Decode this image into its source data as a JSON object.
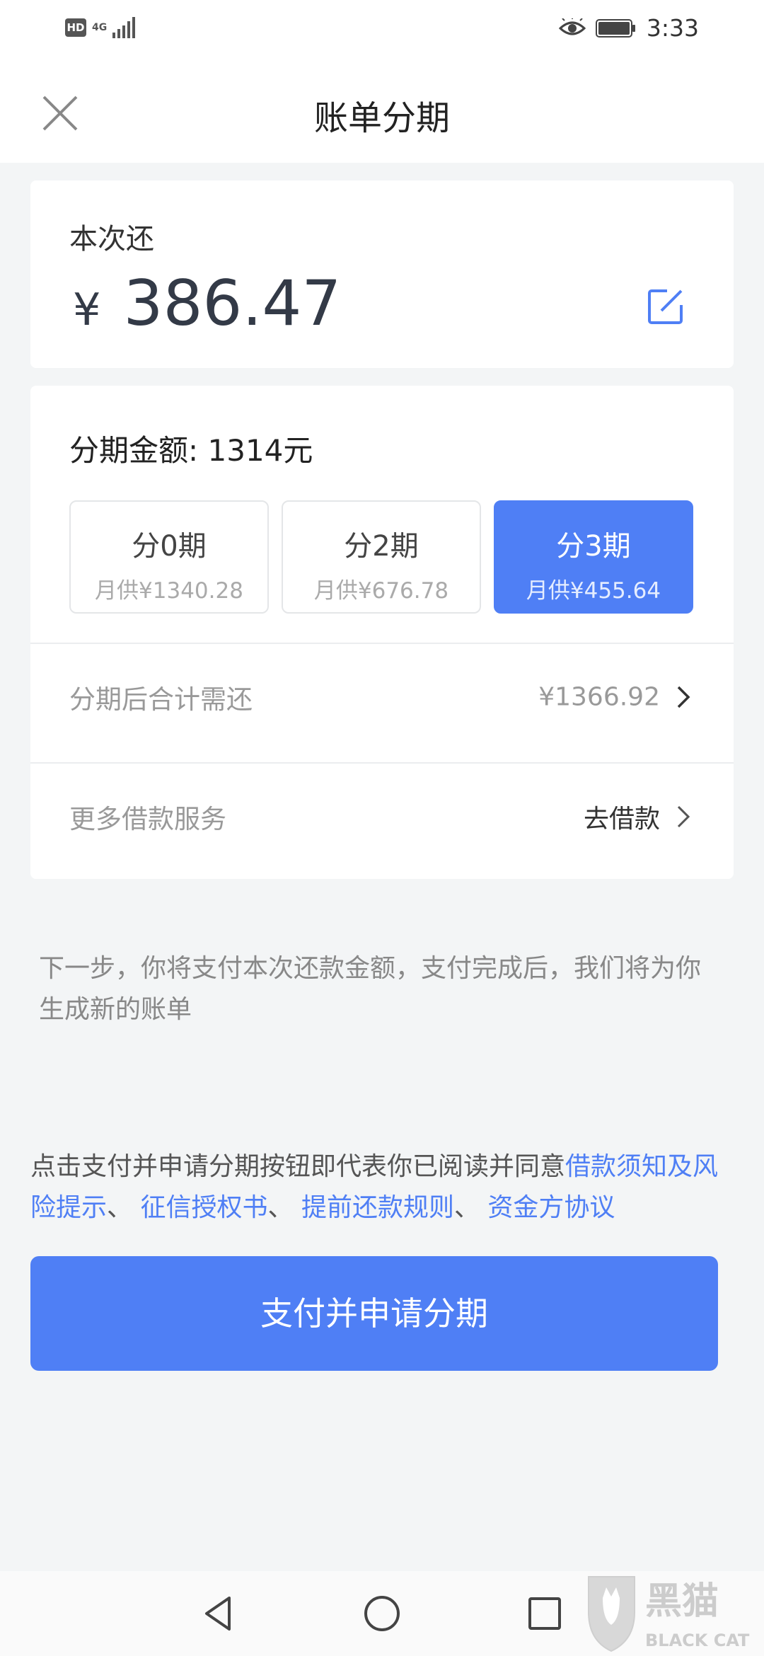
{
  "status_bar": {
    "hd": "HD",
    "network": "4G",
    "time": "3:33"
  },
  "header": {
    "title": "账单分期"
  },
  "payment": {
    "label": "本次还",
    "currency": "¥",
    "amount": "386.47"
  },
  "installment": {
    "amount_text": "分期金额: 1314元",
    "options": [
      {
        "title": "分0期",
        "monthly": "月供¥1340.28",
        "selected": false
      },
      {
        "title": "分2期",
        "monthly": "月供¥676.78",
        "selected": false
      },
      {
        "title": "分3期",
        "monthly": "月供¥455.64",
        "selected": true
      }
    ],
    "total_label": "分期后合计需还",
    "total_value": "¥1366.92",
    "more_label": "更多借款服务",
    "more_action": "去借款"
  },
  "note": "下一步，你将支付本次还款金额，支付完成后，我们将为你生成新的账单",
  "agreement": {
    "prefix": "点击支付并申请分期按钮即代表你已阅读并同意",
    "links": [
      "借款须知及风险提示",
      "征信授权书",
      "提前还款规则",
      "资金方协议"
    ],
    "separator": "、 "
  },
  "submit_label": "支付并申请分期",
  "watermark": {
    "cn": "黑猫",
    "en": "BLACK CAT"
  },
  "colors": {
    "accent": "#4f7ff5",
    "background": "#f3f5f6"
  }
}
